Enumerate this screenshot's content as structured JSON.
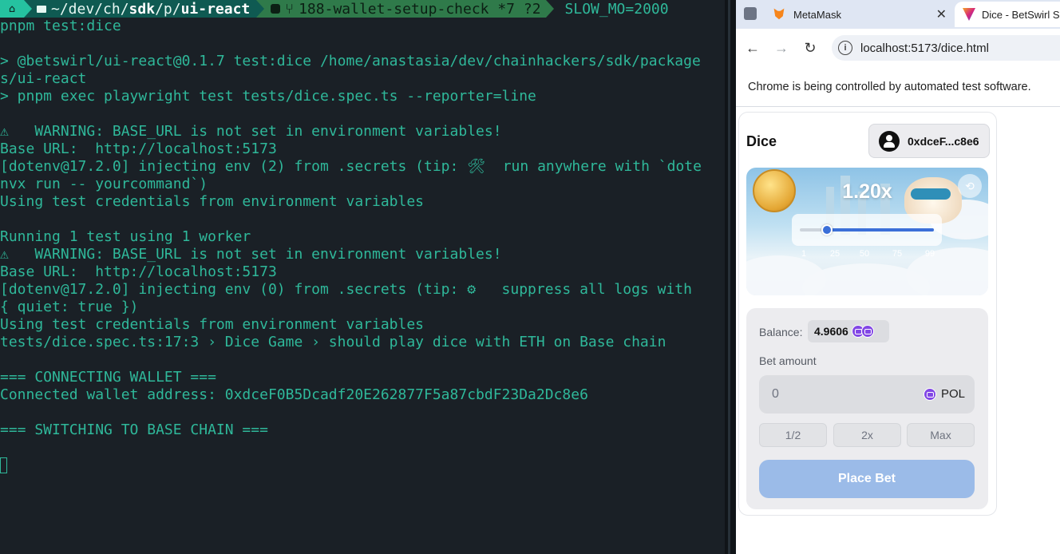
{
  "terminal": {
    "prompt": {
      "path_prefix": "~/dev/ch/",
      "path_bold1": "sdk",
      "path_mid": "/p/",
      "path_bold2": "ui-react",
      "branch": "188-wallet-setup-check *7 ?2",
      "env": "SLOW_MO=2000"
    },
    "lines": [
      "pnpm test:dice",
      "",
      "> @betswirl/ui-react@0.1.7 test:dice /home/anastasia/dev/chainhackers/sdk/package",
      "s/ui-react",
      "> pnpm exec playwright test tests/dice.spec.ts --reporter=line",
      "",
      "⚠   WARNING: BASE_URL is not set in environment variables!",
      "Base URL:  http://localhost:5173",
      "[dotenv@17.2.0] injecting env (2) from .secrets (tip: 🛠  run anywhere with `dote",
      "nvx run -- yourcommand`)",
      "Using test credentials from environment variables",
      "",
      "Running 1 test using 1 worker",
      "⚠   WARNING: BASE_URL is not set in environment variables!",
      "Base URL:  http://localhost:5173",
      "[dotenv@17.2.0] injecting env (0) from .secrets (tip: ⚙   suppress all logs with",
      "{ quiet: true })",
      "Using test credentials from environment variables",
      "tests/dice.spec.ts:17:3 › Dice Game › should play dice with ETH on Base chain",
      "",
      "=== CONNECTING WALLET ===",
      "Connected wallet address: 0xdceF0B5Dcadf20E262877F5a87cbdF23Da2Dc8e6",
      "",
      "=== SWITCHING TO BASE CHAIN ===",
      ""
    ]
  },
  "browser": {
    "tabs": [
      {
        "label": "MetaMask",
        "close": "✕"
      },
      {
        "label": "Dice - BetSwirl S"
      }
    ],
    "url": "localhost:5173/dice.html",
    "infobar": "Chrome is being controlled by automated test software."
  },
  "dice": {
    "title": "Dice",
    "wallet": "0xdceF...c8e6",
    "multiplier": "1.20x",
    "slider": {
      "value_fraction": 0.2,
      "ticks": [
        "1",
        "25",
        "50",
        "75",
        "99"
      ]
    },
    "balance_label": "Balance:",
    "balance_value": "4.9606",
    "bet_label": "Bet amount",
    "bet_value": "0",
    "bet_unit": "POL",
    "quick": [
      "1/2",
      "2x",
      "Max"
    ],
    "place_bet": "Place Bet"
  }
}
